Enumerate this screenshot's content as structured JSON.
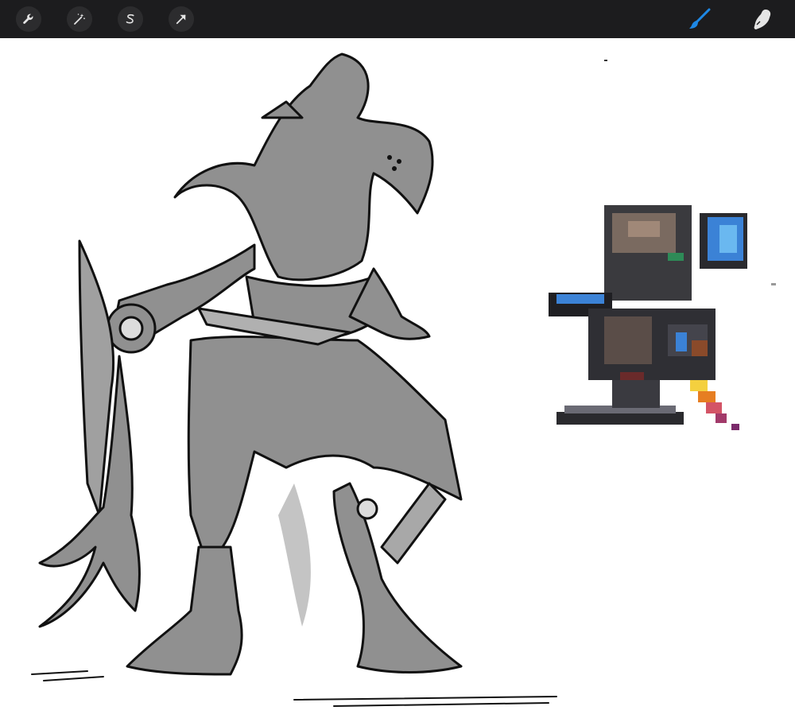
{
  "toolbar": {
    "left_tools": [
      {
        "name": "actions",
        "icon": "wrench-icon"
      },
      {
        "name": "adjustments",
        "icon": "magic-wand-icon"
      },
      {
        "name": "selection",
        "icon": "selection-s-icon"
      },
      {
        "name": "transform",
        "icon": "transform-arrow-icon"
      }
    ],
    "right_tools": [
      {
        "name": "brush",
        "icon": "brush-icon",
        "active": true
      },
      {
        "name": "smudge",
        "icon": "smudge-icon",
        "active": false
      }
    ],
    "active_color": "#1e88e5",
    "inactive_color": "#e5e5e5"
  },
  "canvas": {
    "background": "#ffffff",
    "artwork": [
      "mech-sketch-drawing",
      "pixel-art-mech-sprite"
    ]
  }
}
